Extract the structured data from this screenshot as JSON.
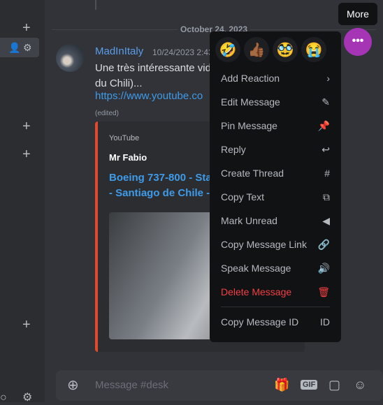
{
  "sidebar": {
    "icons": [
      "plus-icon",
      "add-member-icon",
      "gear-icon",
      "plus-icon",
      "plus-icon",
      "plus-icon",
      "search-icon",
      "gear-icon"
    ]
  },
  "date_divider": "October 24, 2023",
  "message": {
    "username": "MadInItaly",
    "timestamp": "10/24/2023 2:43",
    "text_line1": "Une très intéressante vid",
    "text_line2": "du Chili)...",
    "link": "https://www.youtube.co",
    "edited": "(edited)",
    "embed": {
      "provider": "YouTube",
      "author": "Mr Fabio",
      "title_line1": "Boeing 737-800 - Sta",
      "title_line2": "- Santiago de Chile -"
    }
  },
  "composer": {
    "placeholder": "Message #desk",
    "gif": "GIF"
  },
  "tooltip": "More",
  "more_button": "•••",
  "context_menu": {
    "reactions": [
      "🤣",
      "👍🏾",
      "🥸",
      "😭"
    ],
    "items": [
      {
        "label": "Add Reaction",
        "icon": "›"
      },
      {
        "label": "Edit Message",
        "icon": "✎"
      },
      {
        "label": "Pin Message",
        "icon": "📌"
      },
      {
        "label": "Reply",
        "icon": "↩"
      },
      {
        "label": "Create Thread",
        "icon": "#"
      },
      {
        "label": "Copy Text",
        "icon": "⧉"
      },
      {
        "label": "Mark Unread",
        "icon": "◀"
      },
      {
        "label": "Copy Message Link",
        "icon": "🔗"
      },
      {
        "label": "Speak Message",
        "icon": "🔊"
      },
      {
        "label": "Delete Message",
        "icon": "🗑",
        "danger": true
      },
      {
        "label": "Copy Message ID",
        "icon": "ID"
      }
    ]
  },
  "colors": {
    "accent": "#a535b5",
    "link": "#3f9be8",
    "danger": "#f23f42",
    "embed_border": "#e14b2a"
  }
}
